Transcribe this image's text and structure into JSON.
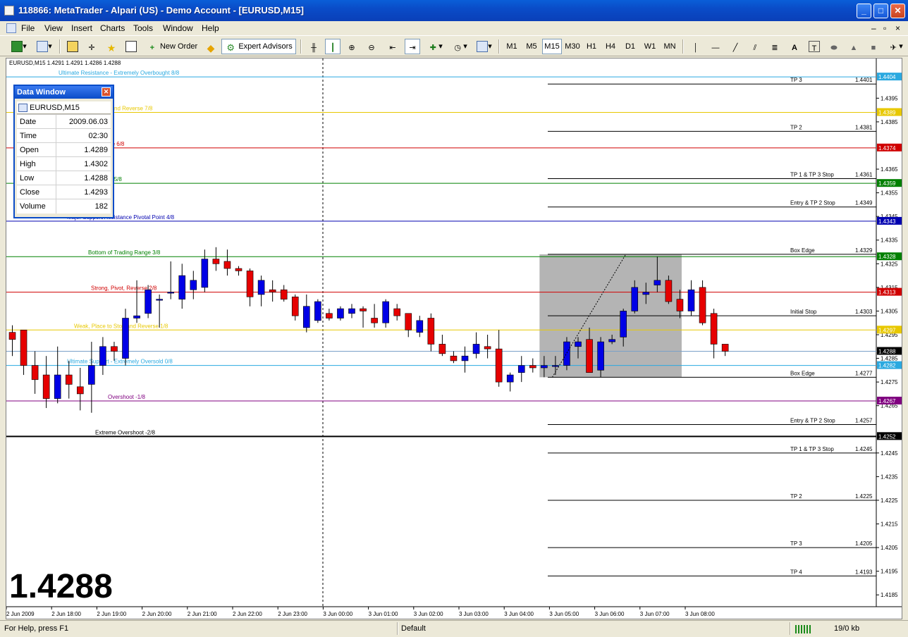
{
  "window": {
    "title": "118866: MetaTrader - Alpari (US) - Demo Account - [EURUSD,M15]",
    "buttons": [
      "_",
      "□",
      "✕"
    ]
  },
  "menu": {
    "items": [
      "File",
      "View",
      "Insert",
      "Charts",
      "Tools",
      "Window",
      "Help"
    ],
    "mdi_buttons": [
      "–",
      "▫",
      "×"
    ]
  },
  "toolbar": {
    "new_order": "New Order",
    "expert_advisors": "Expert Advisors",
    "timeframes": [
      "M1",
      "M5",
      "M15",
      "M30",
      "H1",
      "H4",
      "D1",
      "W1",
      "MN"
    ],
    "active_timeframe": "M15",
    "icons": [
      "new-chart-icon",
      "profiles-icon",
      "market-watch-icon",
      "crosshair-icon",
      "favorites-icon",
      "terminal-icon",
      "new-order-icon",
      "metaeditor-icon",
      "expert-advisors-icon",
      "bar-chart-icon",
      "candlestick-icon",
      "zoom-in-icon",
      "zoom-out-icon",
      "autoscroll-icon",
      "chart-shift-icon",
      "indicators-icon",
      "periods-icon",
      "templates-icon",
      "cursor-icon",
      "horizontal-line-icon",
      "trendline-icon",
      "channel-icon",
      "fibonacci-icon",
      "text-icon",
      "label-icon",
      "ellipse-icon",
      "triangle-icon",
      "rectangle-icon",
      "arrows-icon"
    ]
  },
  "chart": {
    "header": "EURUSD,M15  1.4291 1.4291 1.4286 1.4288",
    "big_price": "1.4288",
    "price_axis": [
      "1.4395",
      "1.4385",
      "1.4365",
      "1.4355",
      "1.4345",
      "1.4335",
      "1.4325",
      "1.4315",
      "1.4305",
      "1.4295",
      "1.4285",
      "1.4275",
      "1.4265",
      "1.4245",
      "1.4235",
      "1.4225",
      "1.4215",
      "1.4205",
      "1.4195",
      "1.4185"
    ],
    "time_axis": [
      "2 Jun 2009",
      "2 Jun 18:00",
      "2 Jun 19:00",
      "2 Jun 20:00",
      "2 Jun 21:00",
      "2 Jun 22:00",
      "2 Jun 23:00",
      "3 Jun 00:00",
      "3 Jun 01:00",
      "3 Jun 02:00",
      "3 Jun 03:00",
      "3 Jun 04:00",
      "3 Jun 05:00",
      "3 Jun 06:00",
      "3 Jun 07:00",
      "3 Jun 08:00"
    ],
    "murrey_lines": [
      {
        "label": "Ultimate Resistance - Extremely Overbought  8/8",
        "price": "1.4404",
        "color": "#2aa9e0"
      },
      {
        "label": "Weak, Place to Stop and Reverse  7/8",
        "price": "1.4389",
        "color": "#e8c800"
      },
      {
        "label": "Strong, Pivot, Reverse  6/8",
        "price": "1.4374",
        "color": "#d00000"
      },
      {
        "label": "Top of Trading Range  5/8",
        "price": "1.4359",
        "color": "#008000"
      },
      {
        "label": "Major Support/Resistance Pivotal Point  4/8",
        "price": "1.4343",
        "color": "#0000b0"
      },
      {
        "label": "Bottom of Trading Range  3/8",
        "price": "1.4328",
        "color": "#008000"
      },
      {
        "label": "Strong, Pivot, Reverse  2/8",
        "price": "1.4313",
        "color": "#d00000"
      },
      {
        "label": "Weak, Place to Stop and Reverse  1/8",
        "price": "1.4297",
        "color": "#e8c800"
      },
      {
        "label": "Ultimate Support - Extremely Oversold  0/8",
        "price": "1.4282",
        "color": "#2aa9e0"
      },
      {
        "label": "Overshoot  -1/8",
        "price": "1.4267",
        "color": "#800080"
      },
      {
        "label": "Extreme Overshoot  -2/8",
        "price": "1.4252",
        "color": "#000000"
      }
    ],
    "current_price_tag": "1.4288",
    "levels": [
      {
        "label": "TP 3",
        "value": "1.4401"
      },
      {
        "label": "TP 2",
        "value": "1.4381"
      },
      {
        "label": "TP 1 & TP 3 Stop",
        "value": "1.4361"
      },
      {
        "label": "Entry & TP 2 Stop",
        "value": "1.4349"
      },
      {
        "label": "Box Edge",
        "value": "1.4329"
      },
      {
        "label": "Initial Stop",
        "value": "1.4303"
      },
      {
        "label": "Box Edge",
        "value": "1.4277"
      },
      {
        "label": "Entry & TP 2 Stop",
        "value": "1.4257"
      },
      {
        "label": "TP 1 & TP 3 Stop",
        "value": "1.4245"
      },
      {
        "label": "TP 2",
        "value": "1.4225"
      },
      {
        "label": "TP 3",
        "value": "1.4205"
      },
      {
        "label": "TP 4",
        "value": "1.4193"
      }
    ]
  },
  "chart_data": {
    "type": "candlestick",
    "symbol": "EURUSD",
    "timeframe": "M15",
    "ylim": [
      1.418,
      1.441
    ],
    "candles": [
      [
        1.4296,
        1.4299,
        1.4286,
        1.4293
      ],
      [
        1.4297,
        1.4297,
        1.4278,
        1.4282
      ],
      [
        1.4282,
        1.4288,
        1.427,
        1.4276
      ],
      [
        1.4278,
        1.4286,
        1.4264,
        1.4268
      ],
      [
        1.4268,
        1.429,
        1.4266,
        1.4278
      ],
      [
        1.4278,
        1.4284,
        1.4268,
        1.4274
      ],
      [
        1.4273,
        1.4281,
        1.4263,
        1.427
      ],
      [
        1.4274,
        1.4292,
        1.4262,
        1.4282
      ],
      [
        1.4282,
        1.4294,
        1.4278,
        1.429
      ],
      [
        1.429,
        1.4292,
        1.4284,
        1.4288
      ],
      [
        1.4285,
        1.4306,
        1.4282,
        1.4302
      ],
      [
        1.4302,
        1.4318,
        1.43,
        1.4303
      ],
      [
        1.4304,
        1.4316,
        1.4302,
        1.4314
      ],
      [
        1.431,
        1.4312,
        1.4298,
        1.431
      ],
      [
        1.4313,
        1.4326,
        1.431,
        1.4313
      ],
      [
        1.431,
        1.4325,
        1.4306,
        1.432
      ],
      [
        1.4314,
        1.4322,
        1.431,
        1.4318
      ],
      [
        1.4315,
        1.4331,
        1.4313,
        1.4327
      ],
      [
        1.4327,
        1.4332,
        1.4322,
        1.4325
      ],
      [
        1.4326,
        1.4331,
        1.432,
        1.4323
      ],
      [
        1.4323,
        1.4324,
        1.432,
        1.4322
      ],
      [
        1.4322,
        1.4323,
        1.4307,
        1.4311
      ],
      [
        1.4312,
        1.432,
        1.4307,
        1.4318
      ],
      [
        1.4314,
        1.4318,
        1.4309,
        1.4313
      ],
      [
        1.4314,
        1.4316,
        1.4309,
        1.431
      ],
      [
        1.4311,
        1.4312,
        1.4301,
        1.4303
      ],
      [
        1.4298,
        1.4312,
        1.4296,
        1.4307
      ],
      [
        1.4301,
        1.431,
        1.43,
        1.4309
      ],
      [
        1.4304,
        1.4306,
        1.4301,
        1.4302
      ],
      [
        1.4302,
        1.4307,
        1.4301,
        1.4306
      ],
      [
        1.4304,
        1.4308,
        1.4302,
        1.4306
      ],
      [
        1.4306,
        1.4307,
        1.4298,
        1.4305
      ],
      [
        1.4302,
        1.4308,
        1.4298,
        1.43
      ],
      [
        1.43,
        1.431,
        1.4298,
        1.4309
      ],
      [
        1.4306,
        1.4308,
        1.4301,
        1.4303
      ],
      [
        1.4304,
        1.4304,
        1.4294,
        1.4297
      ],
      [
        1.4296,
        1.4303,
        1.4294,
        1.4301
      ],
      [
        1.4302,
        1.4304,
        1.4288,
        1.4291
      ],
      [
        1.4291,
        1.4295,
        1.4286,
        1.4287
      ],
      [
        1.4286,
        1.4288,
        1.4283,
        1.4284
      ],
      [
        1.4284,
        1.429,
        1.4279,
        1.4286
      ],
      [
        1.4287,
        1.4296,
        1.4285,
        1.4291
      ],
      [
        1.429,
        1.4295,
        1.4285,
        1.4289
      ],
      [
        1.4289,
        1.4297,
        1.4273,
        1.4275
      ],
      [
        1.4275,
        1.4279,
        1.4271,
        1.4278
      ],
      [
        1.4279,
        1.4286,
        1.4275,
        1.4282
      ],
      [
        1.4282,
        1.4285,
        1.4279,
        1.4281
      ],
      [
        1.4281,
        1.4286,
        1.4277,
        1.4282
      ],
      [
        1.4282,
        1.4286,
        1.4278,
        1.4282
      ],
      [
        1.4282,
        1.4294,
        1.428,
        1.4292
      ],
      [
        1.429,
        1.4294,
        1.4285,
        1.4292
      ],
      [
        1.4293,
        1.4298,
        1.4279,
        1.4279
      ],
      [
        1.428,
        1.4294,
        1.4277,
        1.4292
      ],
      [
        1.4292,
        1.4295,
        1.4291,
        1.4293
      ],
      [
        1.4294,
        1.4306,
        1.429,
        1.4305
      ],
      [
        1.4305,
        1.4318,
        1.4304,
        1.4315
      ],
      [
        1.4312,
        1.4317,
        1.4308,
        1.4313
      ],
      [
        1.4316,
        1.4328,
        1.4313,
        1.4318
      ],
      [
        1.4318,
        1.432,
        1.4308,
        1.4309
      ],
      [
        1.431,
        1.4314,
        1.4302,
        1.4305
      ],
      [
        1.4305,
        1.4318,
        1.4303,
        1.4314
      ],
      [
        1.4315,
        1.4318,
        1.4299,
        1.43
      ],
      [
        1.4304,
        1.4306,
        1.4285,
        1.4291
      ],
      [
        1.4291,
        1.4291,
        1.4286,
        1.4288
      ]
    ]
  },
  "data_window": {
    "title": "Data Window",
    "symbol": "EURUSD,M15",
    "rows": [
      {
        "label": "Date",
        "value": "2009.06.03"
      },
      {
        "label": "Time",
        "value": "02:30"
      },
      {
        "label": "Open",
        "value": "1.4289"
      },
      {
        "label": "High",
        "value": "1.4302"
      },
      {
        "label": "Low",
        "value": "1.4288"
      },
      {
        "label": "Close",
        "value": "1.4293"
      },
      {
        "label": "Volume",
        "value": "182"
      }
    ]
  },
  "status": {
    "help": "For Help, press F1",
    "profile": "Default",
    "traffic": "19/0 kb"
  },
  "colors": {
    "bull": "#0000e6",
    "bear": "#e60000",
    "box": "#b4b4b4"
  }
}
